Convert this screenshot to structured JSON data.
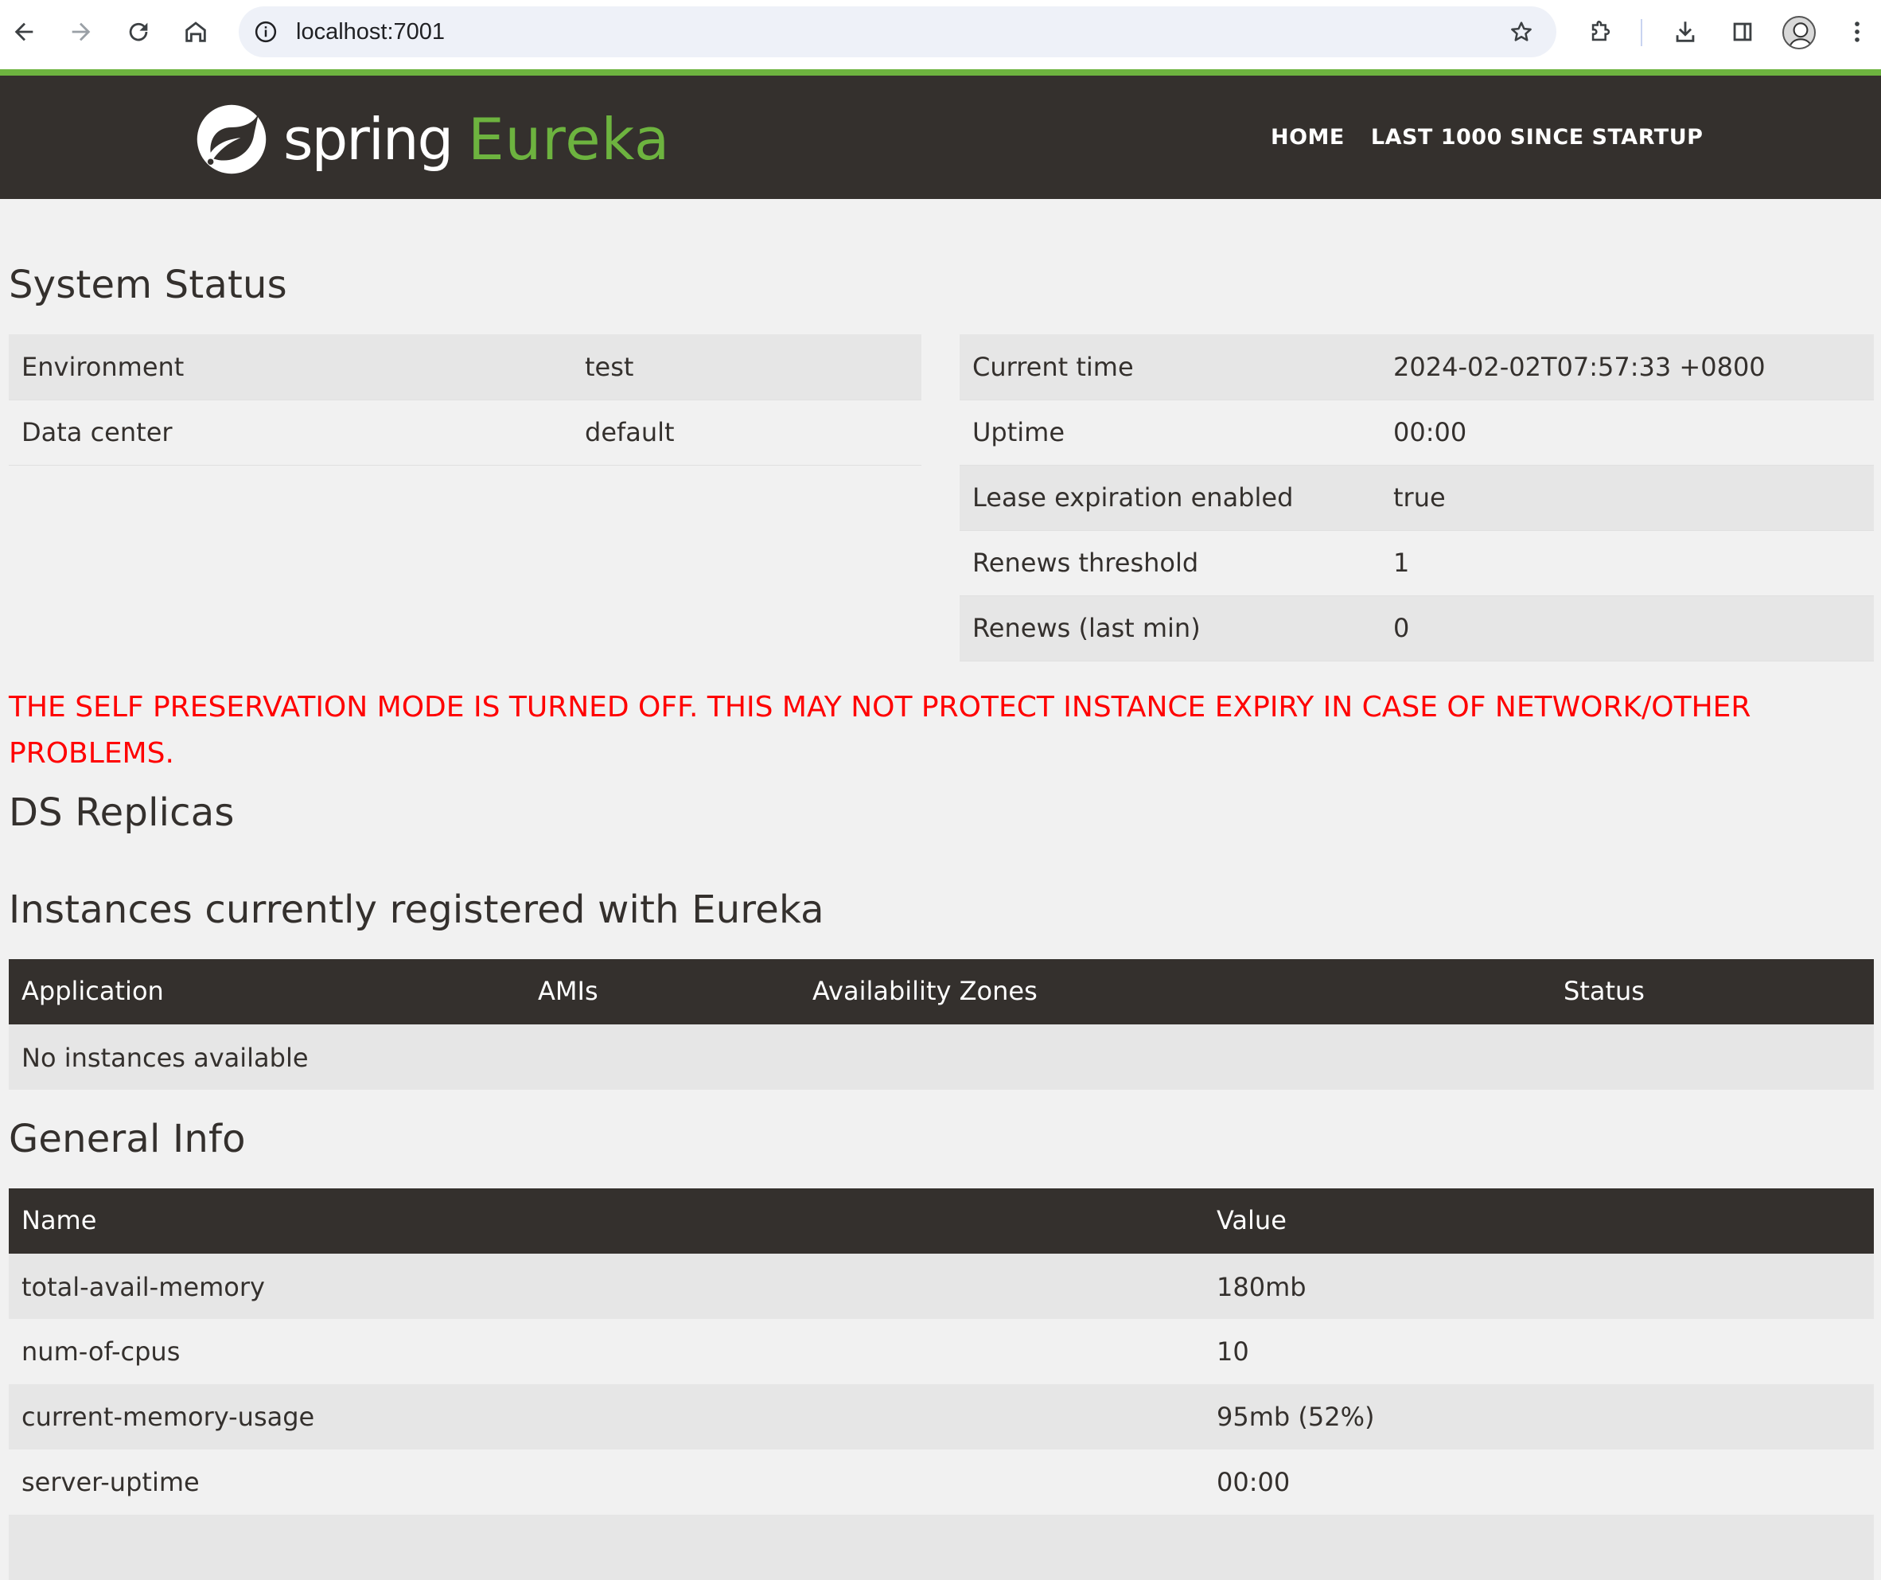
{
  "browser": {
    "url": "localhost:7001"
  },
  "nav": {
    "brand_spring": "spring",
    "brand_eureka": "Eureka",
    "home": "HOME",
    "last1000": "LAST 1000 SINCE STARTUP"
  },
  "system_status": {
    "title": "System Status",
    "left": [
      {
        "label": "Environment",
        "value": "test"
      },
      {
        "label": "Data center",
        "value": "default"
      }
    ],
    "right": [
      {
        "label": "Current time",
        "value": "2024-02-02T07:57:33 +0800"
      },
      {
        "label": "Uptime",
        "value": "00:00"
      },
      {
        "label": "Lease expiration enabled",
        "value": "true"
      },
      {
        "label": "Renews threshold",
        "value": "1"
      },
      {
        "label": "Renews (last min)",
        "value": "0"
      }
    ]
  },
  "warning": "THE SELF PRESERVATION MODE IS TURNED OFF. THIS MAY NOT PROTECT INSTANCE EXPIRY IN CASE OF NETWORK/OTHER PROBLEMS.",
  "ds_replicas": {
    "title": "DS Replicas"
  },
  "instances": {
    "title": "Instances currently registered with Eureka",
    "columns": [
      "Application",
      "AMIs",
      "Availability Zones",
      "Status"
    ],
    "empty": "No instances available"
  },
  "general_info": {
    "title": "General Info",
    "columns": [
      "Name",
      "Value"
    ],
    "rows": [
      {
        "name": "total-avail-memory",
        "value": "180mb"
      },
      {
        "name": "num-of-cpus",
        "value": "10"
      },
      {
        "name": "current-memory-usage",
        "value": "95mb (52%)"
      },
      {
        "name": "server-uptime",
        "value": "00:00"
      }
    ]
  }
}
